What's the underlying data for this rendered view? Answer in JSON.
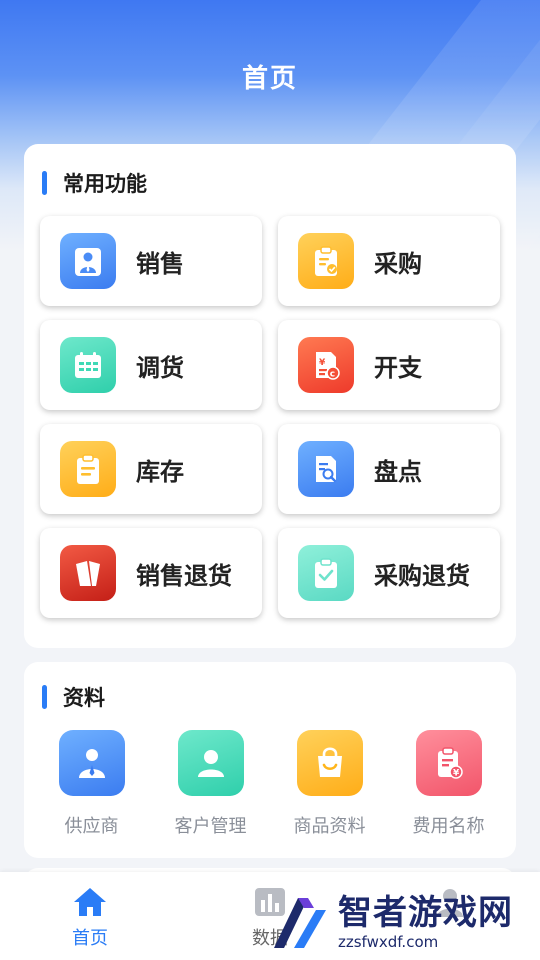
{
  "header": {
    "title": "首页"
  },
  "common": {
    "title": "常用功能",
    "items": [
      {
        "label": "销售",
        "icon": "salesperson-icon",
        "color": "#4a8cf6"
      },
      {
        "label": "采购",
        "icon": "clipboard-check-icon",
        "color": "#ffbe2e"
      },
      {
        "label": "调货",
        "icon": "calendar-grid-icon",
        "color": "#3fd9b6"
      },
      {
        "label": "开支",
        "icon": "expense-receipt-icon",
        "color": "#f44f37"
      },
      {
        "label": "库存",
        "icon": "clipboard-list-icon",
        "color": "#ffbe2e"
      },
      {
        "label": "盘点",
        "icon": "document-search-icon",
        "color": "#3b7cf0"
      },
      {
        "label": "销售退货",
        "icon": "return-box-icon",
        "color": "#d92b1f"
      },
      {
        "label": "采购退货",
        "icon": "clipboard-tick-icon",
        "color": "#6ee3cc"
      }
    ]
  },
  "info": {
    "title": "资料",
    "items": [
      {
        "label": "供应商",
        "icon": "supplier-person-icon",
        "color": "#3b7cf0"
      },
      {
        "label": "客户管理",
        "icon": "customer-person-icon",
        "color": "#36d6b0"
      },
      {
        "label": "商品资料",
        "icon": "shopping-bag-icon",
        "color": "#ffb61c"
      },
      {
        "label": "费用名称",
        "icon": "fee-clipboard-icon",
        "color": "#f2556a"
      }
    ]
  },
  "tabbar": {
    "items": [
      {
        "label": "首页",
        "icon": "home-icon",
        "active": true
      },
      {
        "label": "数据",
        "icon": "bar-chart-icon",
        "active": false
      },
      {
        "label": "",
        "icon": "user-icon",
        "active": false
      }
    ]
  },
  "watermark": {
    "main": "智者游戏网",
    "sub": "zzsfwxdf.com"
  }
}
